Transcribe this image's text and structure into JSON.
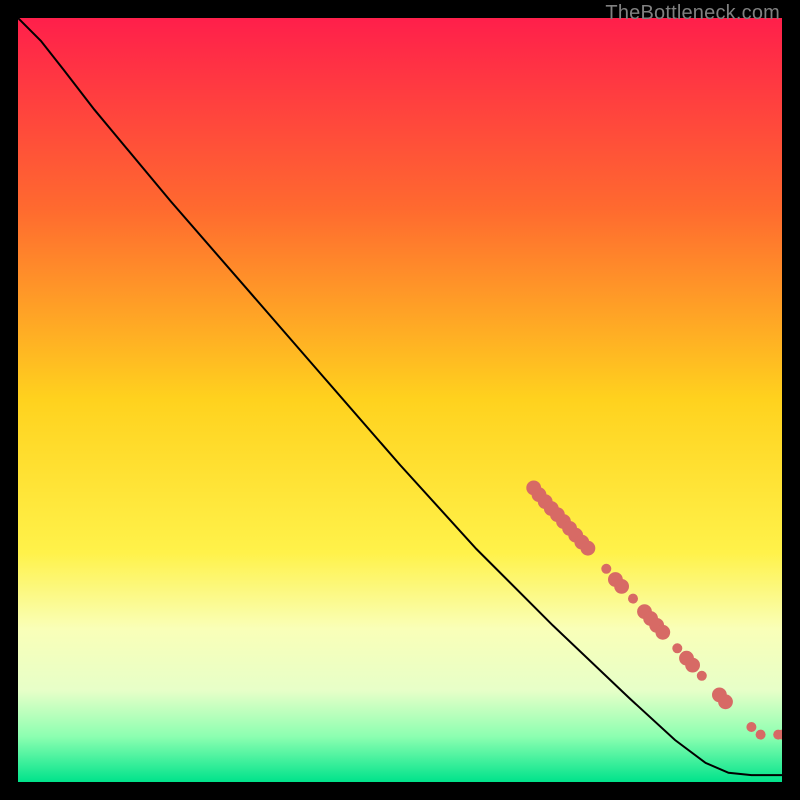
{
  "watermark": "TheBottleneck.com",
  "chart_data": {
    "type": "line",
    "title": "",
    "xlabel": "",
    "ylabel": "",
    "xlim": [
      0,
      100
    ],
    "ylim": [
      0,
      100
    ],
    "gradient_stops": [
      {
        "offset": 0,
        "color": "#ff1f4b"
      },
      {
        "offset": 25,
        "color": "#ff6a2f"
      },
      {
        "offset": 50,
        "color": "#ffd21e"
      },
      {
        "offset": 70,
        "color": "#fff24a"
      },
      {
        "offset": 80,
        "color": "#f9ffb8"
      },
      {
        "offset": 88,
        "color": "#e7ffc8"
      },
      {
        "offset": 94,
        "color": "#8dffb1"
      },
      {
        "offset": 100,
        "color": "#00e38b"
      }
    ],
    "curve": [
      {
        "x": 0.0,
        "y": 100.0
      },
      {
        "x": 3.0,
        "y": 97.0
      },
      {
        "x": 6.0,
        "y": 93.2
      },
      {
        "x": 10.0,
        "y": 88.0
      },
      {
        "x": 20.0,
        "y": 76.0
      },
      {
        "x": 30.0,
        "y": 64.5
      },
      {
        "x": 40.0,
        "y": 53.0
      },
      {
        "x": 50.0,
        "y": 41.5
      },
      {
        "x": 60.0,
        "y": 30.5
      },
      {
        "x": 70.0,
        "y": 20.5
      },
      {
        "x": 80.0,
        "y": 11.0
      },
      {
        "x": 86.0,
        "y": 5.5
      },
      {
        "x": 90.0,
        "y": 2.5
      },
      {
        "x": 93.0,
        "y": 1.2
      },
      {
        "x": 96.0,
        "y": 0.9
      },
      {
        "x": 100.0,
        "y": 0.9
      }
    ],
    "markers": [
      {
        "x": 67.5,
        "y": 38.5,
        "r": 1.2
      },
      {
        "x": 68.2,
        "y": 37.6,
        "r": 1.2
      },
      {
        "x": 69.0,
        "y": 36.7,
        "r": 1.2
      },
      {
        "x": 69.8,
        "y": 35.8,
        "r": 1.2
      },
      {
        "x": 70.6,
        "y": 35.0,
        "r": 1.2
      },
      {
        "x": 71.4,
        "y": 34.1,
        "r": 1.2
      },
      {
        "x": 72.2,
        "y": 33.2,
        "r": 1.2
      },
      {
        "x": 73.0,
        "y": 32.3,
        "r": 1.2
      },
      {
        "x": 73.8,
        "y": 31.4,
        "r": 1.2
      },
      {
        "x": 74.6,
        "y": 30.6,
        "r": 1.2
      },
      {
        "x": 77.0,
        "y": 27.9,
        "r": 1.0
      },
      {
        "x": 78.2,
        "y": 26.5,
        "r": 1.2
      },
      {
        "x": 79.0,
        "y": 25.6,
        "r": 1.2
      },
      {
        "x": 80.5,
        "y": 24.0,
        "r": 1.0
      },
      {
        "x": 82.0,
        "y": 22.3,
        "r": 1.2
      },
      {
        "x": 82.8,
        "y": 21.4,
        "r": 1.2
      },
      {
        "x": 83.6,
        "y": 20.5,
        "r": 1.2
      },
      {
        "x": 84.4,
        "y": 19.6,
        "r": 1.2
      },
      {
        "x": 86.3,
        "y": 17.5,
        "r": 1.0
      },
      {
        "x": 87.5,
        "y": 16.2,
        "r": 1.2
      },
      {
        "x": 88.3,
        "y": 15.3,
        "r": 1.2
      },
      {
        "x": 89.5,
        "y": 13.9,
        "r": 1.0
      },
      {
        "x": 91.8,
        "y": 11.4,
        "r": 1.2
      },
      {
        "x": 92.6,
        "y": 10.5,
        "r": 1.2
      },
      {
        "x": 96.0,
        "y": 7.2,
        "r": 1.0
      },
      {
        "x": 97.2,
        "y": 6.2,
        "r": 1.0
      },
      {
        "x": 99.5,
        "y": 6.2,
        "r": 1.0
      },
      {
        "x": 100.0,
        "y": 6.2,
        "r": 1.0
      }
    ],
    "marker_color": "#d76a65"
  }
}
